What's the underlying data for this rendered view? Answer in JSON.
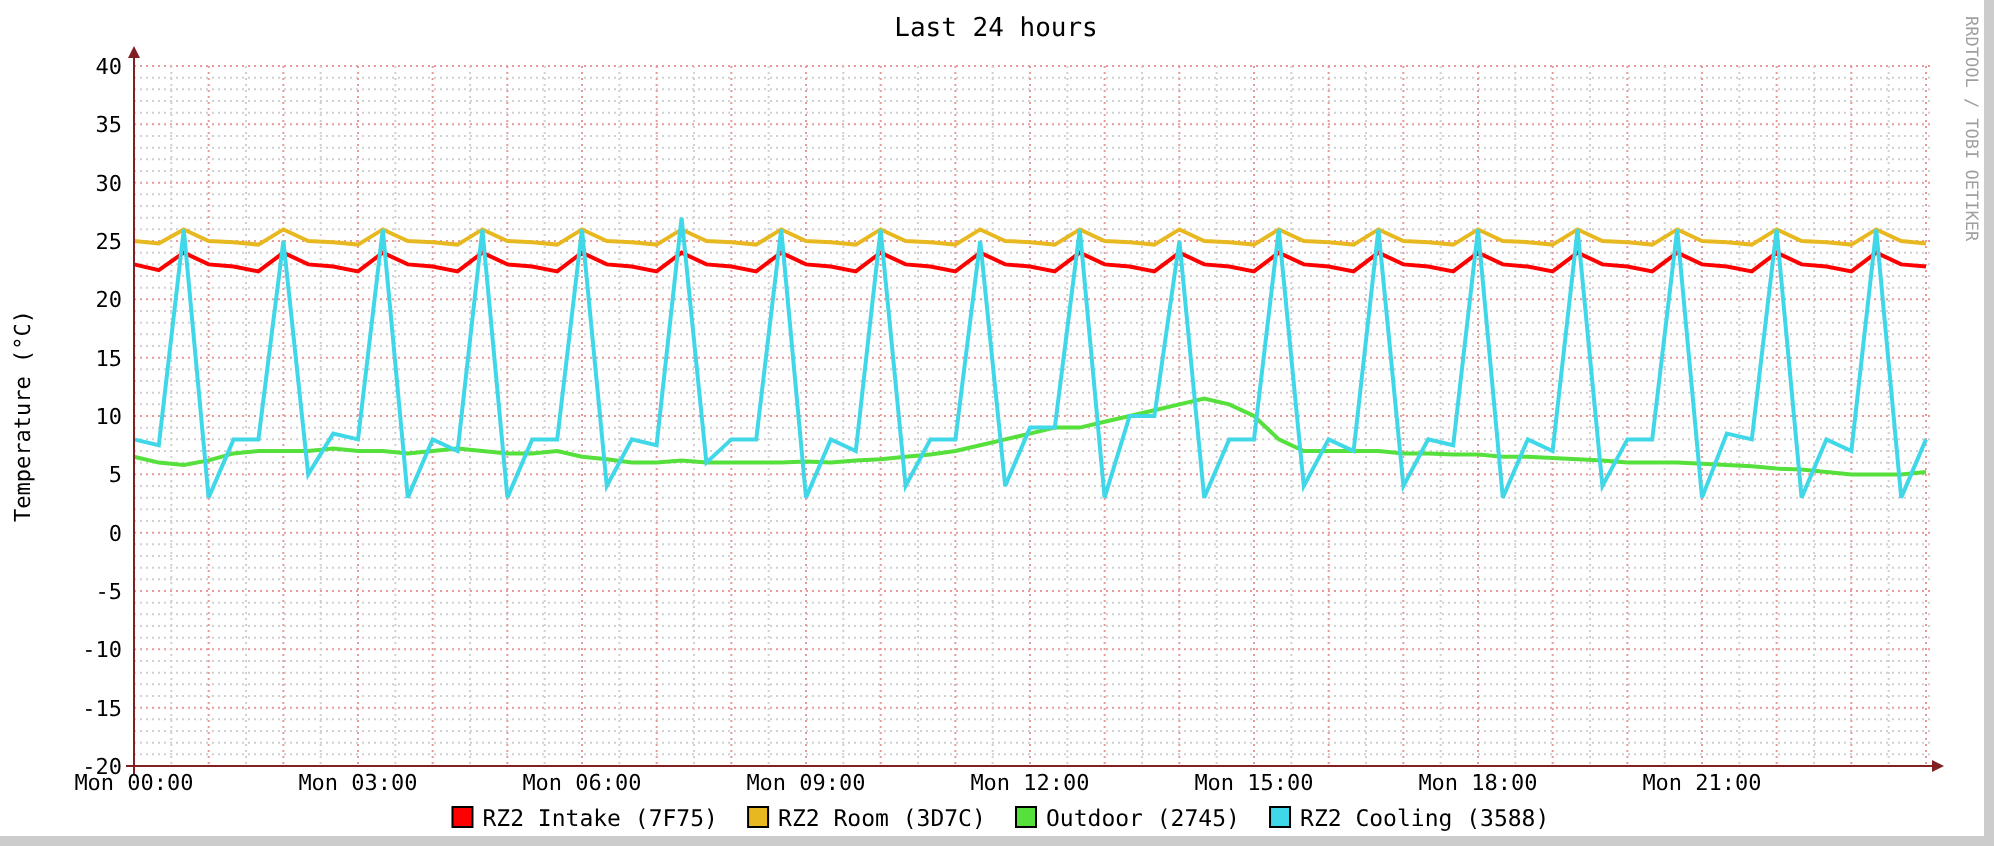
{
  "chart_data": {
    "type": "line",
    "title": "Last 24 hours",
    "ylabel": "Temperature (°C)",
    "grid": true,
    "legend": "bottom",
    "ylim": [
      -20,
      40
    ],
    "categories": [
      "Mon 00:00",
      null,
      null,
      null,
      null,
      null,
      null,
      null,
      null,
      "Mon 03:00",
      null,
      null,
      null,
      null,
      null,
      null,
      null,
      null,
      "Mon 06:00",
      null,
      null,
      null,
      null,
      null,
      null,
      null,
      null,
      "Mon 09:00",
      null,
      null,
      null,
      null,
      null,
      null,
      null,
      null,
      "Mon 12:00",
      null,
      null,
      null,
      null,
      null,
      null,
      null,
      null,
      "Mon 15:00",
      null,
      null,
      null,
      null,
      null,
      null,
      null,
      null,
      "Mon 18:00",
      null,
      null,
      null,
      null,
      null,
      null,
      null,
      null,
      "Mon 21:00",
      null,
      null,
      null,
      null,
      null,
      null,
      null,
      null,
      null
    ],
    "yticks": [
      -20,
      -15,
      -10,
      -5,
      0,
      5,
      10,
      15,
      20,
      25,
      30,
      35,
      40
    ],
    "series": [
      {
        "name": "RZ2 Intake (7F75)",
        "color": "#ff0000",
        "values": [
          23,
          22.5,
          24,
          23,
          22.8,
          22.4,
          24,
          23,
          22.8,
          22.4,
          24,
          23,
          22.8,
          22.4,
          24,
          23,
          22.8,
          22.4,
          24,
          23,
          22.8,
          22.4,
          24,
          23,
          22.8,
          22.4,
          24,
          23,
          22.8,
          22.4,
          24,
          23,
          22.8,
          22.4,
          24,
          23,
          22.8,
          22.4,
          24,
          23,
          22.8,
          22.4,
          24,
          23,
          22.8,
          22.4,
          24,
          23,
          22.8,
          22.4,
          24,
          23,
          22.8,
          22.4,
          24,
          23,
          22.8,
          22.4,
          24,
          23,
          22.8,
          22.4,
          24,
          23,
          22.8,
          22.4,
          24,
          23,
          22.8,
          22.4,
          24,
          23,
          22.8
        ]
      },
      {
        "name": "RZ2 Room (3D7C)",
        "color": "#e8b820",
        "values": [
          25,
          24.8,
          26,
          25,
          24.9,
          24.7,
          26,
          25,
          24.9,
          24.7,
          26,
          25,
          24.9,
          24.7,
          26,
          25,
          24.9,
          24.7,
          26,
          25,
          24.9,
          24.7,
          26,
          25,
          24.9,
          24.7,
          26,
          25,
          24.9,
          24.7,
          26,
          25,
          24.9,
          24.7,
          26,
          25,
          24.9,
          24.7,
          26,
          25,
          24.9,
          24.7,
          26,
          25,
          24.9,
          24.7,
          26,
          25,
          24.9,
          24.7,
          26,
          25,
          24.9,
          24.7,
          26,
          25,
          24.9,
          24.7,
          26,
          25,
          24.9,
          24.7,
          26,
          25,
          24.9,
          24.7,
          26,
          25,
          24.9,
          24.7,
          26,
          25,
          24.8
        ]
      },
      {
        "name": "Outdoor (2745)",
        "color": "#55e03c",
        "values": [
          6.5,
          6,
          5.8,
          6.2,
          6.8,
          7,
          7,
          7,
          7.2,
          7,
          7,
          6.8,
          7,
          7.2,
          7,
          6.8,
          6.8,
          7,
          6.5,
          6.3,
          6,
          6,
          6.2,
          6,
          6,
          6,
          6,
          6.1,
          6,
          6.2,
          6.3,
          6.5,
          6.7,
          7,
          7.5,
          8,
          8.5,
          9,
          9,
          9.5,
          10,
          10.5,
          11,
          11.5,
          11,
          10,
          8,
          7,
          7,
          7,
          7,
          6.8,
          6.8,
          6.7,
          6.7,
          6.5,
          6.5,
          6.4,
          6.3,
          6.2,
          6,
          6,
          6,
          5.9,
          5.8,
          5.7,
          5.5,
          5.4,
          5.2,
          5,
          5,
          5,
          5.2
        ]
      },
      {
        "name": "RZ2 Cooling (3588)",
        "color": "#40d8e8",
        "values": [
          8,
          7.5,
          26,
          3,
          8,
          8,
          25,
          5,
          8.5,
          8,
          26,
          3,
          8,
          7,
          26,
          3,
          8,
          8,
          26,
          4,
          8,
          7.5,
          27,
          6,
          8,
          8,
          26,
          3,
          8,
          7,
          26,
          4,
          8,
          8,
          25,
          4,
          9,
          9,
          26,
          3,
          10,
          10,
          25,
          3,
          8,
          8,
          26,
          4,
          8,
          7,
          26,
          4,
          8,
          7.5,
          26,
          3,
          8,
          7,
          26,
          4,
          8,
          8,
          26,
          3,
          8.5,
          8,
          26,
          3,
          8,
          7,
          26,
          3,
          8
        ]
      }
    ]
  },
  "credit": "RRDTOOL / TOBI OETIKER"
}
